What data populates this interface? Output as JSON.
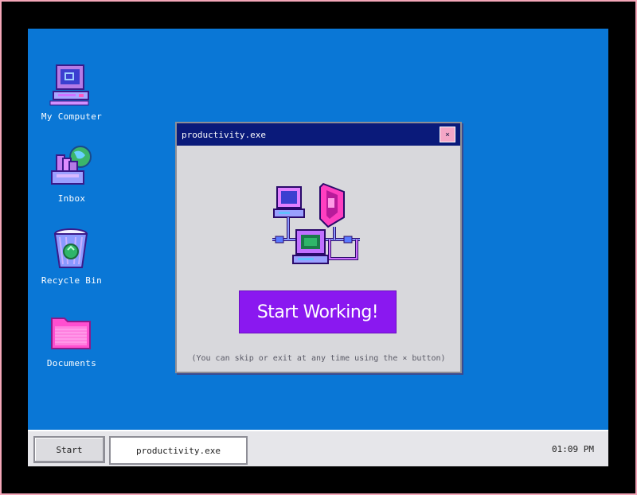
{
  "desktop": {
    "icons": [
      {
        "label": "My Computer",
        "icon": "computer-icon"
      },
      {
        "label": "Inbox",
        "icon": "inbox-icon"
      },
      {
        "label": "Recycle Bin",
        "icon": "recycle-bin-icon"
      },
      {
        "label": "Documents",
        "icon": "folder-icon"
      }
    ]
  },
  "window": {
    "title": "productivity.exe",
    "close_label": "×",
    "button_label": "Start Working!",
    "hint": "(You can skip or exit at any time using the × button)"
  },
  "taskbar": {
    "start_label": "Start",
    "task_label": "productivity.exe",
    "clock": "01:09 PM"
  },
  "colors": {
    "desktop": "#0a77d6",
    "frame": "#f4a6b8",
    "titlebar": "#0a1a7a",
    "accent_button": "#8a18f0"
  }
}
